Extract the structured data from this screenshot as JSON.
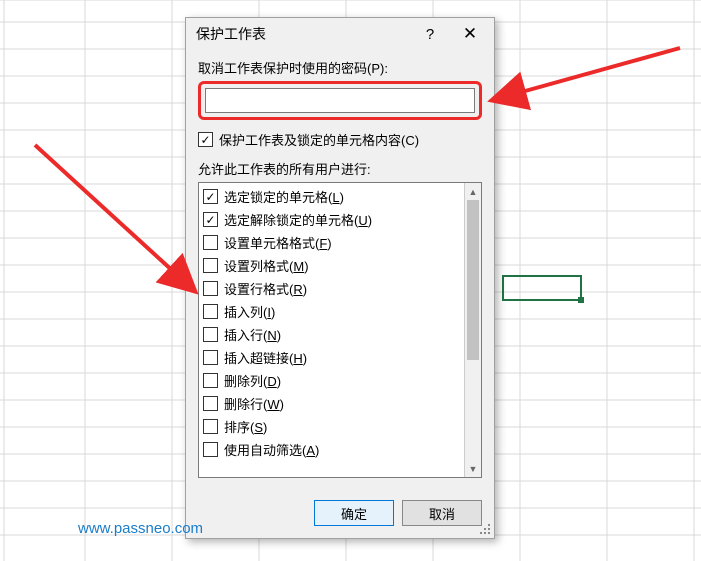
{
  "dialog": {
    "title": "保护工作表",
    "password_label": "取消工作表保护时使用的密码(P):",
    "password_value": "",
    "protect_check_label": "保护工作表及锁定的单元格内容(C)",
    "protect_checked": true,
    "allow_label": "允许此工作表的所有用户进行:",
    "permissions": [
      {
        "label": "选定锁定的单元格",
        "shortcut": "L",
        "checked": true
      },
      {
        "label": "选定解除锁定的单元格",
        "shortcut": "U",
        "checked": true
      },
      {
        "label": "设置单元格格式",
        "shortcut": "F",
        "checked": false
      },
      {
        "label": "设置列格式",
        "shortcut": "M",
        "checked": false
      },
      {
        "label": "设置行格式",
        "shortcut": "R",
        "checked": false
      },
      {
        "label": "插入列",
        "shortcut": "I",
        "checked": false
      },
      {
        "label": "插入行",
        "shortcut": "N",
        "checked": false
      },
      {
        "label": "插入超链接",
        "shortcut": "H",
        "checked": false
      },
      {
        "label": "删除列",
        "shortcut": "D",
        "checked": false
      },
      {
        "label": "删除行",
        "shortcut": "W",
        "checked": false
      },
      {
        "label": "排序",
        "shortcut": "S",
        "checked": false
      },
      {
        "label": "使用自动筛选",
        "shortcut": "A",
        "checked": false
      }
    ],
    "ok_label": "确定",
    "cancel_label": "取消"
  },
  "watermark": "www.passneo.com"
}
